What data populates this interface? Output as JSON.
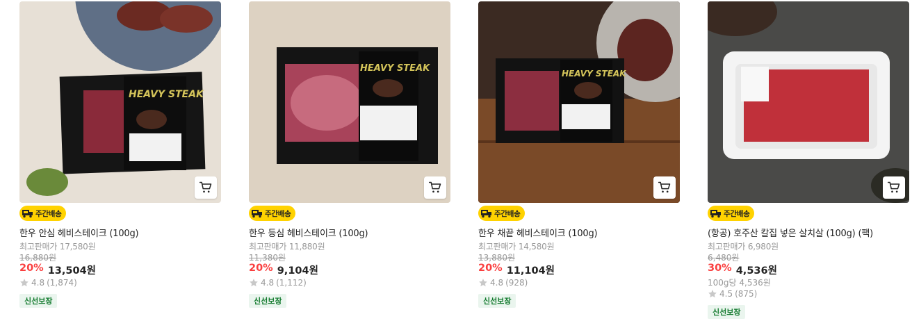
{
  "products": [
    {
      "delivery_badge": "주간배송",
      "name": "한우 안심 헤비스테이크 (100g)",
      "max_price": "최고판매가 17,580원",
      "original_price": "16,880원",
      "discount": "20%",
      "price": "13,504원",
      "unit_price": "",
      "rating": "4.8",
      "reviews": "(1,874)",
      "tag": "신선보장",
      "package_text": "HEAVY STEAK"
    },
    {
      "delivery_badge": "주간배송",
      "name": "한우 등심 헤비스테이크 (100g)",
      "max_price": "최고판매가 11,880원",
      "original_price": "11,380원",
      "discount": "20%",
      "price": "9,104원",
      "unit_price": "",
      "rating": "4.8",
      "reviews": "(1,112)",
      "tag": "신선보장",
      "package_text": "HEAVY STEAK"
    },
    {
      "delivery_badge": "주간배송",
      "name": "한우 채끝 헤비스테이크 (100g)",
      "max_price": "최고판매가 14,580원",
      "original_price": "13,880원",
      "discount": "20%",
      "price": "11,104원",
      "unit_price": "",
      "rating": "4.8",
      "reviews": "(928)",
      "tag": "신선보장",
      "package_text": "HEAVY STEAK"
    },
    {
      "delivery_badge": "주간배송",
      "name": "(항공) 호주산 칼집 넣은 살치살 (100g) (팩)",
      "max_price": "최고판매가 6,980원",
      "original_price": "6,480원",
      "discount": "30%",
      "price": "4,536원",
      "unit_price": "100g당 4,536원",
      "rating": "4.5",
      "reviews": "(875)",
      "tag": "신선보장",
      "package_text": ""
    }
  ],
  "icons": {
    "cart": "shopping-cart-icon",
    "truck": "delivery-truck-icon",
    "star": "star-icon"
  },
  "colors": {
    "discount": "#fa3f3f",
    "badge_bg": "#ffd200",
    "fresh_tag_bg": "#eaf5ee",
    "fresh_tag_text": "#127a2d",
    "muted_text": "#999999"
  }
}
